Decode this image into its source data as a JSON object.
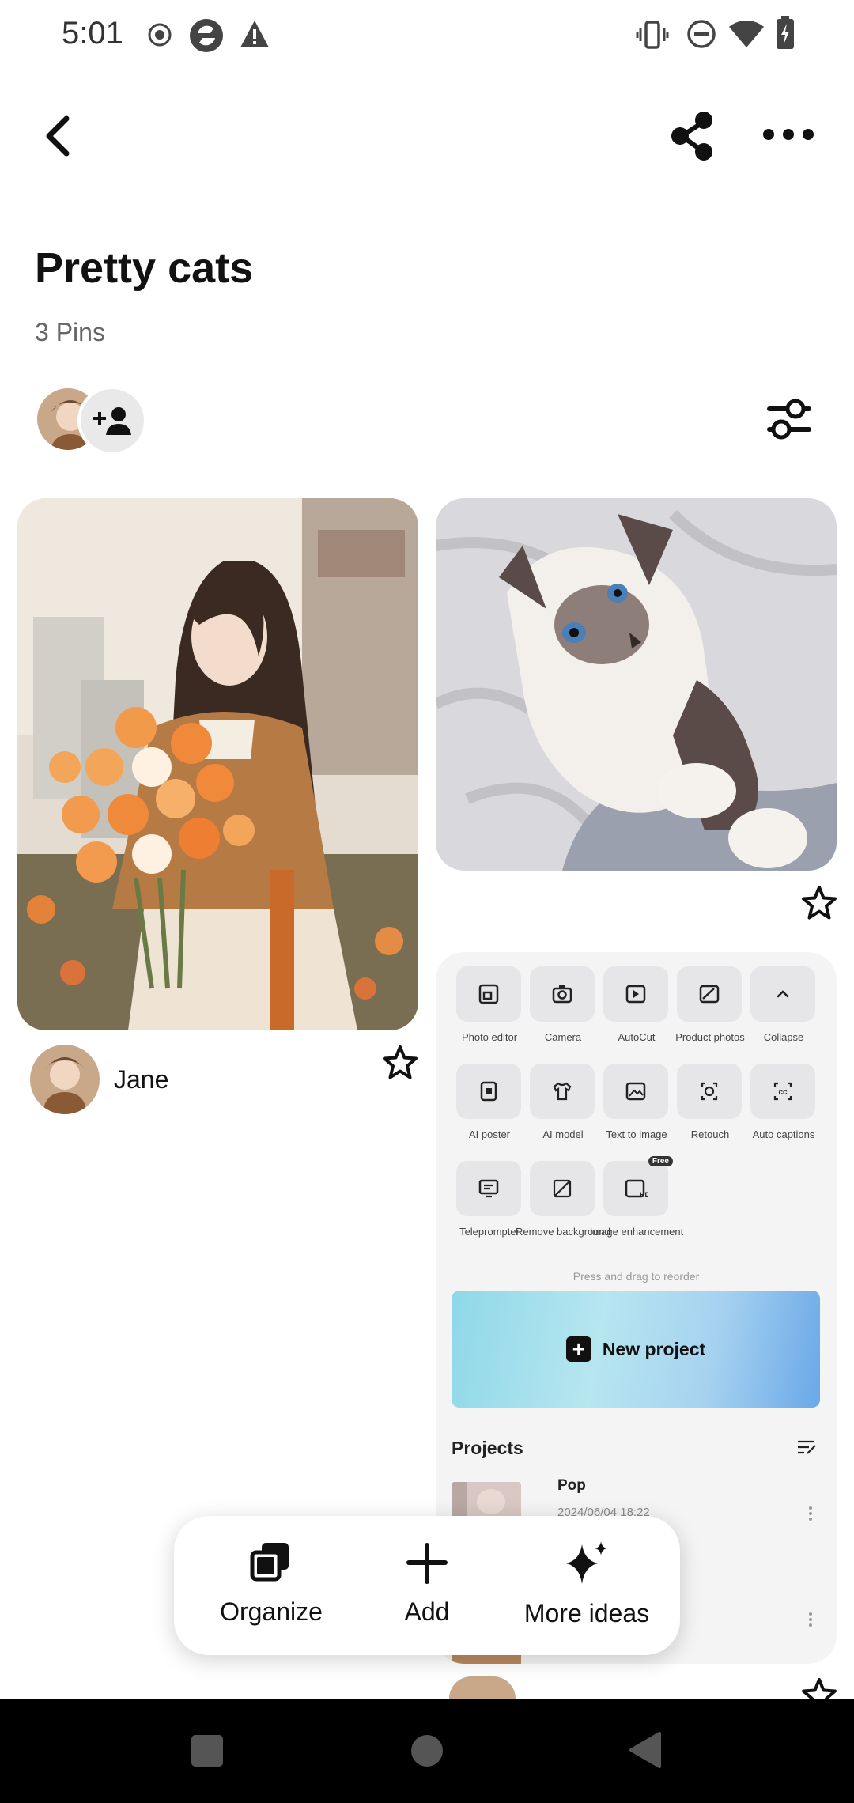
{
  "status_bar": {
    "time": "5:01"
  },
  "board": {
    "title": "Pretty cats",
    "pin_count": "3 Pins"
  },
  "pins": [
    {
      "id": "girl",
      "pinner_name": "Jane"
    },
    {
      "id": "cat"
    },
    {
      "id": "app"
    }
  ],
  "app_pin": {
    "tools": [
      {
        "label": "Photo editor"
      },
      {
        "label": "Camera"
      },
      {
        "label": "AutoCut"
      },
      {
        "label": "Product photos"
      },
      {
        "label": "Collapse"
      },
      {
        "label": "AI poster"
      },
      {
        "label": "AI model"
      },
      {
        "label": "Text to image"
      },
      {
        "label": "Retouch"
      },
      {
        "label": "Auto captions"
      },
      {
        "label": "Teleprompter"
      },
      {
        "label": "Remove background"
      },
      {
        "label": "Image enhancement",
        "badge": "Free"
      }
    ],
    "reorder_hint": "Press and drag to reorder",
    "new_project": "New project",
    "projects_title": "Projects",
    "project": {
      "name": "Pop",
      "date": "2024/06/04 18:22"
    }
  },
  "action_bar": {
    "organize": "Organize",
    "add": "Add",
    "more_ideas": "More ideas"
  }
}
